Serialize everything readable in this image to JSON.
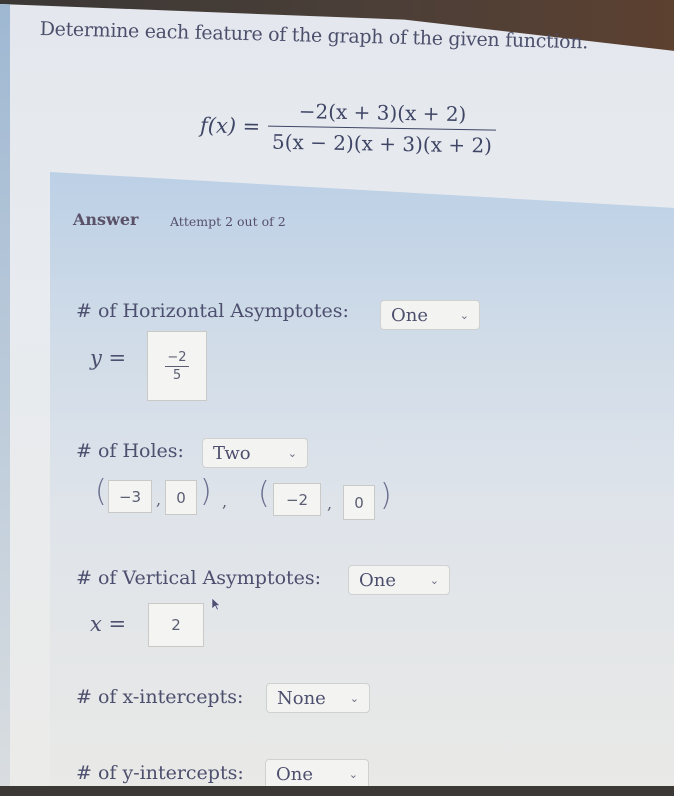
{
  "question": {
    "prompt": "Determine each feature of the graph of the given function.",
    "function": {
      "lhs": "f(x) =",
      "numerator": "−2(x + 3)(x + 2)",
      "denominator": "5(x − 2)(x + 3)(x + 2)"
    }
  },
  "answer": {
    "label": "Answer",
    "attempt": "Attempt 2 out of 2"
  },
  "horizontal_asymptotes": {
    "label": "# of Horizontal Asymptotes:",
    "selected": "One",
    "var_label": "y =",
    "value_numerator": "−2",
    "value_denominator": "5"
  },
  "holes": {
    "label": "# of Holes:",
    "selected": "Two",
    "open_paren": "(",
    "close_paren": ")",
    "comma": ",",
    "points": [
      {
        "x": "−3",
        "y": "0"
      },
      {
        "x": "−2",
        "y": "0"
      }
    ]
  },
  "vertical_asymptotes": {
    "label": "# of Vertical Asymptotes:",
    "selected": "One",
    "var_label": "x =",
    "value": "2"
  },
  "x_intercepts": {
    "label": "# of x-intercepts:",
    "selected": "None"
  },
  "y_intercepts": {
    "label": "# of y-intercepts:",
    "selected": "One"
  },
  "icons": {
    "dropdown": "chevron-down-icon",
    "cursor": "mouse-pointer-icon"
  },
  "colors": {
    "text": "#4d4f6e",
    "panel": "#cfdbe8",
    "input_bg": "#f4f4f2"
  }
}
